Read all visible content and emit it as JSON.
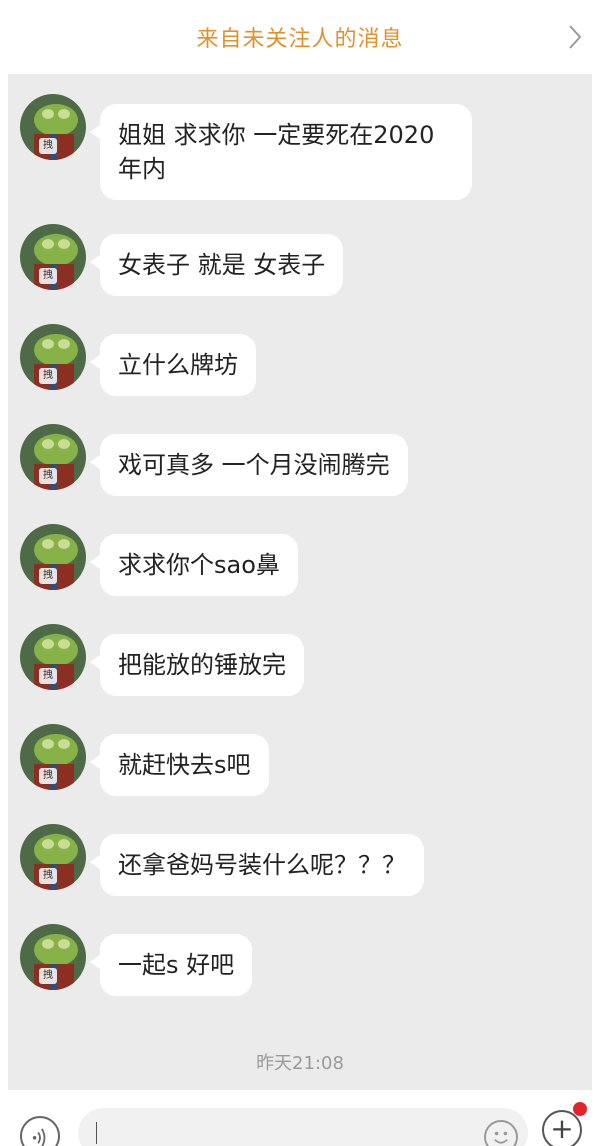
{
  "header": {
    "title": "来自未关注人的消息",
    "chevron_icon": "chevron-right-icon"
  },
  "contact": {
    "avatar_badge": "拽"
  },
  "messages": [
    {
      "line1": "姐姐  求求你 一定要死在2020",
      "line2": "年内"
    },
    {
      "line1": "女表子 就是 女表子",
      "line2": ""
    },
    {
      "line1": "立什么牌坊",
      "line2": ""
    },
    {
      "line1": "戏可真多 一个月没闹腾完",
      "line2": ""
    },
    {
      "line1": "求求你个sao鼻",
      "line2": ""
    },
    {
      "line1": "把能放的锤放完",
      "line2": ""
    },
    {
      "line1": "就赶快去s吧",
      "line2": ""
    },
    {
      "line1": "还拿爸妈号装什么呢？？？",
      "line2": ""
    },
    {
      "line1": "一起s 好吧",
      "line2": ""
    }
  ],
  "timestamp": "昨天21:08",
  "input_bar": {
    "voice_icon": "voice-icon",
    "emoji_icon": "emoji-icon",
    "plus_icon": "plus-icon",
    "plus_glyph": "+",
    "notification_color": "#e0262a"
  },
  "colors": {
    "accent": "#e0922a",
    "chat_background": "#ebebeb",
    "bubble": "#ffffff"
  }
}
